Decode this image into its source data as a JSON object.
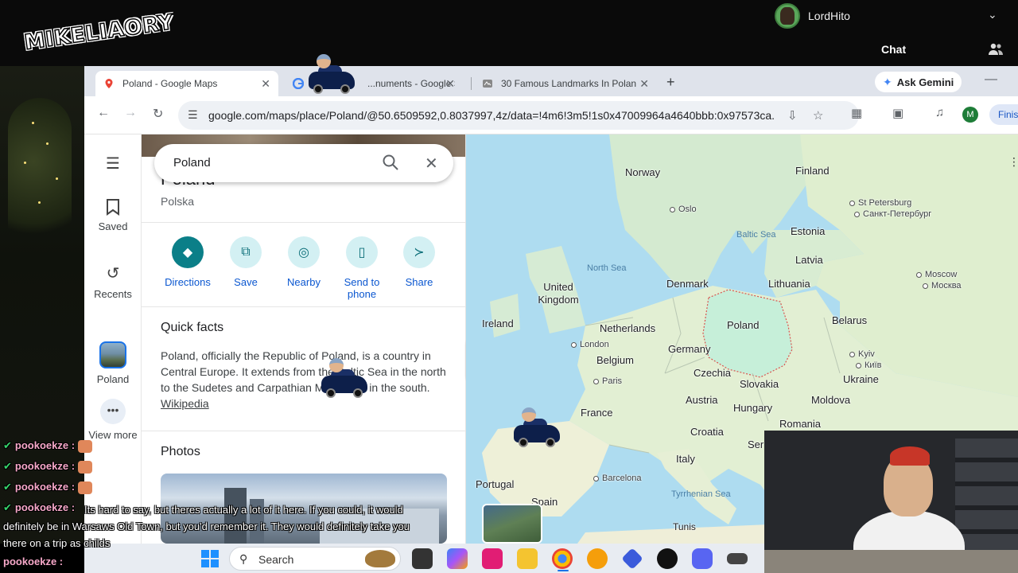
{
  "stream": {
    "logo_text": "MIKELIAORY",
    "user_name": "LordHito",
    "chat_title": "Chat"
  },
  "browser": {
    "tabs": [
      {
        "label": "Poland - Google Maps",
        "active": true
      },
      {
        "label": "...numents - Google S",
        "active": false
      },
      {
        "label": "30 Famous Landmarks In Polan",
        "active": false
      }
    ],
    "ask_gemini": "Ask Gemini",
    "url": "google.com/maps/place/Poland/@50.6509592,0.8037997,4z/data=!4m6!3m5!1s0x47009964a4640bbb:0x97573ca...",
    "profile_initial": "M",
    "finish_label": "Finis"
  },
  "maps": {
    "rail": {
      "saved": "Saved",
      "recents": "Recents",
      "poland": "Poland",
      "view_more": "View more"
    },
    "search": {
      "query": "Poland"
    },
    "place": {
      "title": "Poland",
      "subtitle": "Polska"
    },
    "actions": [
      {
        "label": "Directions"
      },
      {
        "label": "Save"
      },
      {
        "label": "Nearby"
      },
      {
        "label": "Send to phone"
      },
      {
        "label": "Share"
      }
    ],
    "quick_facts": {
      "title": "Quick facts",
      "text": "Poland, officially the Republic of Poland, is a country in Central Europe. It extends from the Baltic Sea in the north to the Sudetes and Carpathian Mountains in the south.",
      "link": "Wikipedia"
    },
    "photos_title": "Photos",
    "map_labels": {
      "norway": "Norway",
      "finland": "Finland",
      "oslo": "Oslo",
      "st_petersburg": "St Petersburg",
      "st_petersburg_cyr": "Санкт-Петербург",
      "baltic_sea": "Baltic Sea",
      "estonia": "Estonia",
      "latvia": "Latvia",
      "north_sea": "North Sea",
      "denmark": "Denmark",
      "lithuania": "Lithuania",
      "moscow": "Moscow",
      "moscow_cyr": "Москва",
      "united_kingdom": "United Kingdom",
      "ireland": "Ireland",
      "netherlands": "Netherlands",
      "poland": "Poland",
      "belarus": "Belarus",
      "london": "London",
      "germany": "Germany",
      "belgium": "Belgium",
      "kyiv": "Kyiv",
      "kyiv_cyr": "Київ",
      "czechia": "Czechia",
      "paris": "Paris",
      "ukraine": "Ukraine",
      "slovakia": "Slovakia",
      "austria": "Austria",
      "moldova": "Moldova",
      "france": "France",
      "hungary": "Hungary",
      "romania": "Romania",
      "croatia": "Croatia",
      "italy": "Italy",
      "serbia_partial": "Ser",
      "barcelona": "Barcelona",
      "portugal": "Portugal",
      "tyrrhenian_sea": "Tyrrhenian Sea",
      "spain": "Spain",
      "tunis": "Tunis"
    }
  },
  "chat": {
    "rows": [
      {
        "user": "pookoekze :"
      },
      {
        "user": "pookoekze :"
      },
      {
        "user": "pookoekze :"
      },
      {
        "user": "pookoekze :"
      }
    ],
    "message": "Its hard to say, but theres actually a lot of it here. If you could, it would definitely be in Warsaws Old Town, but you'd remember it. They would definitely take you there on a trip as childs",
    "last_user": "pookoekze :"
  },
  "taskbar": {
    "search_label": "Search"
  },
  "colors": {
    "accent_teal": "#0b7f88",
    "poland_fill": "#c6efd9",
    "border_red": "#d9534f"
  }
}
